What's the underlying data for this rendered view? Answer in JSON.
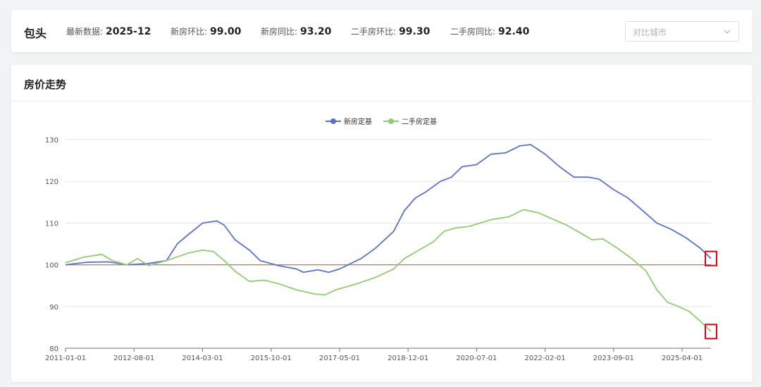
{
  "header": {
    "city": "包头",
    "stats": [
      {
        "label": "最新数据:",
        "value": "2025-12"
      },
      {
        "label": "新房环比:",
        "value": "99.00"
      },
      {
        "label": "新房同比:",
        "value": "93.20"
      },
      {
        "label": "二手房环比:",
        "value": "99.30"
      },
      {
        "label": "二手房同比:",
        "value": "92.40"
      }
    ],
    "compare_select": {
      "placeholder": "对比城市",
      "icon": "chevron-down-icon"
    }
  },
  "panel": {
    "title": "房价走势"
  },
  "colors": {
    "new_house": "#5b73c6",
    "second_hand": "#91cc75",
    "baseline": "#e06666",
    "highlight_box": "#e0001b"
  },
  "chart_data": {
    "type": "line",
    "xlabel": "",
    "ylabel": "",
    "x_tick_labels": [
      "2011-01-01",
      "2012-08-01",
      "2014-03-01",
      "2015-10-01",
      "2017-05-01",
      "2018-12-01",
      "2020-07-01",
      "2022-02-01",
      "2023-09-01",
      "2025-04-01"
    ],
    "x_range": [
      "2011-01",
      "2025-12"
    ],
    "ylim": [
      80,
      130
    ],
    "y_ticks": [
      80,
      90,
      100,
      110,
      120,
      130
    ],
    "grid": true,
    "legend_position": "top-center",
    "reference_line": {
      "y": 100
    },
    "series": [
      {
        "name": "新房定基",
        "points": [
          [
            "2011-01",
            100.0
          ],
          [
            "2011-07",
            100.6
          ],
          [
            "2012-01",
            100.7
          ],
          [
            "2012-06",
            100.0
          ],
          [
            "2012-12",
            100.3
          ],
          [
            "2013-05",
            101.0
          ],
          [
            "2013-08",
            105.0
          ],
          [
            "2013-11",
            107.2
          ],
          [
            "2014-03",
            110.0
          ],
          [
            "2014-07",
            110.5
          ],
          [
            "2014-09",
            109.5
          ],
          [
            "2014-12",
            106.0
          ],
          [
            "2015-04",
            103.5
          ],
          [
            "2015-07",
            101.0
          ],
          [
            "2015-12",
            99.8
          ],
          [
            "2016-05",
            99.0
          ],
          [
            "2016-07",
            98.2
          ],
          [
            "2016-11",
            98.8
          ],
          [
            "2017-02",
            98.2
          ],
          [
            "2017-05",
            99.0
          ],
          [
            "2017-11",
            101.5
          ],
          [
            "2018-03",
            104.0
          ],
          [
            "2018-08",
            108.0
          ],
          [
            "2018-11",
            113.0
          ],
          [
            "2019-02",
            116.0
          ],
          [
            "2019-05",
            117.5
          ],
          [
            "2019-09",
            120.0
          ],
          [
            "2019-12",
            121.0
          ],
          [
            "2020-03",
            123.5
          ],
          [
            "2020-07",
            124.0
          ],
          [
            "2020-11",
            126.5
          ],
          [
            "2021-03",
            126.8
          ],
          [
            "2021-07",
            128.5
          ],
          [
            "2021-10",
            128.8
          ],
          [
            "2022-02",
            126.5
          ],
          [
            "2022-06",
            123.5
          ],
          [
            "2022-10",
            121.0
          ],
          [
            "2023-02",
            121.0
          ],
          [
            "2023-05",
            120.5
          ],
          [
            "2023-09",
            118.0
          ],
          [
            "2024-01",
            116.0
          ],
          [
            "2024-05",
            113.0
          ],
          [
            "2024-09",
            110.0
          ],
          [
            "2025-01",
            108.5
          ],
          [
            "2025-05",
            106.5
          ],
          [
            "2025-09",
            104.0
          ],
          [
            "2025-12",
            101.5
          ]
        ]
      },
      {
        "name": "二手房定基",
        "points": [
          [
            "2011-01",
            100.5
          ],
          [
            "2011-06",
            101.8
          ],
          [
            "2011-11",
            102.5
          ],
          [
            "2012-02",
            101.0
          ],
          [
            "2012-06",
            100.0
          ],
          [
            "2012-09",
            101.5
          ],
          [
            "2012-12",
            99.8
          ],
          [
            "2013-05",
            101.0
          ],
          [
            "2013-11",
            102.8
          ],
          [
            "2014-03",
            103.5
          ],
          [
            "2014-06",
            103.2
          ],
          [
            "2014-09",
            101.0
          ],
          [
            "2014-12",
            98.5
          ],
          [
            "2015-04",
            96.0
          ],
          [
            "2015-08",
            96.3
          ],
          [
            "2015-12",
            95.5
          ],
          [
            "2016-05",
            94.0
          ],
          [
            "2016-10",
            93.0
          ],
          [
            "2017-01",
            92.8
          ],
          [
            "2017-04",
            94.0
          ],
          [
            "2017-10",
            95.5
          ],
          [
            "2018-03",
            97.0
          ],
          [
            "2018-08",
            99.0
          ],
          [
            "2018-11",
            101.5
          ],
          [
            "2019-03",
            103.5
          ],
          [
            "2019-07",
            105.5
          ],
          [
            "2019-10",
            108.0
          ],
          [
            "2020-01",
            108.8
          ],
          [
            "2020-05",
            109.2
          ],
          [
            "2020-08",
            110.0
          ],
          [
            "2020-11",
            110.8
          ],
          [
            "2021-04",
            111.5
          ],
          [
            "2021-08",
            113.2
          ],
          [
            "2021-12",
            112.5
          ],
          [
            "2022-04",
            111.0
          ],
          [
            "2022-08",
            109.5
          ],
          [
            "2022-12",
            107.5
          ],
          [
            "2023-03",
            106.0
          ],
          [
            "2023-06",
            106.2
          ],
          [
            "2023-10",
            104.0
          ],
          [
            "2024-02",
            101.5
          ],
          [
            "2024-06",
            98.5
          ],
          [
            "2024-09",
            94.0
          ],
          [
            "2024-12",
            91.0
          ],
          [
            "2025-03",
            90.0
          ],
          [
            "2025-06",
            88.8
          ],
          [
            "2025-09",
            86.5
          ],
          [
            "2025-12",
            84.0
          ]
        ]
      }
    ],
    "highlighted_points": [
      {
        "series": "新房定基",
        "x": "2025-12"
      },
      {
        "series": "二手房定基",
        "x": "2025-12"
      }
    ]
  }
}
